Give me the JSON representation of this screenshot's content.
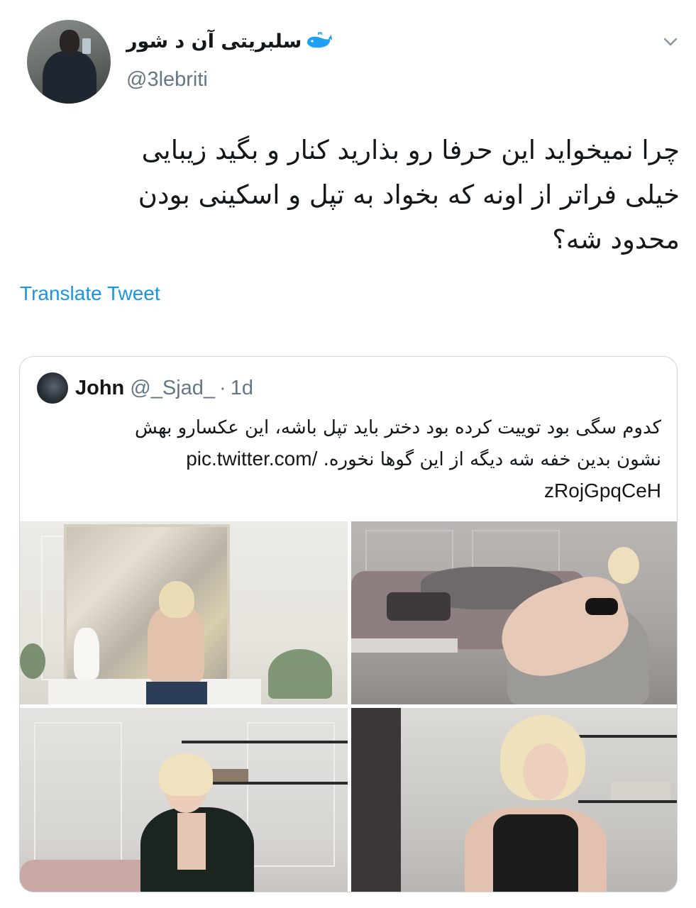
{
  "tweet": {
    "display_name": "سلبریتی آن د شور",
    "handle": "@3lebriti",
    "text_lines": [
      "چرا نمیخواید این حرفا رو بذارید کنار و بگید زیبایی",
      "خیلی فراتر از اونه که بخواد به تپل و اسکینی بودن",
      "محدود شه؟"
    ],
    "translate_label": "Translate Tweet"
  },
  "quoted": {
    "name": "John",
    "handle": "@_Sjad_",
    "separator": "·",
    "time": "1d",
    "text_line1": "کدوم سگی بود توییت کرده بود دختر باید تپل باشه، این عکسارو بهش",
    "text_line2_rtl": "نشون بدین خفه شه دیگه از این گوها نخوره.",
    "text_line2_link": "pic.twitter.com/",
    "text_line3": "zRojGpqCeH"
  },
  "icons": {
    "verified_like": "whale-icon",
    "menu": "chevron-down-icon"
  },
  "colors": {
    "link": "#1b95e0",
    "secondary_text": "#657786",
    "border": "#ccd6dd"
  }
}
